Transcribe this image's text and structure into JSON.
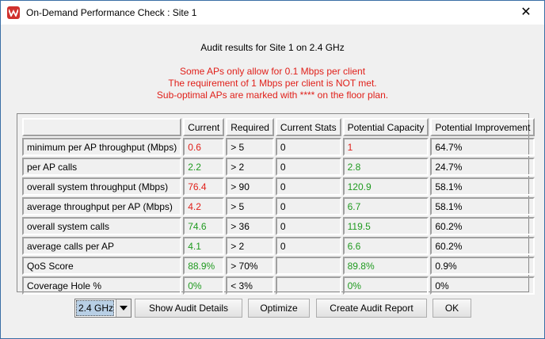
{
  "window": {
    "title": "On-Demand Performance Check : Site 1",
    "close_label": "✕"
  },
  "heading": "Audit results for Site 1 on 2.4 GHz",
  "warnings": [
    "Some APs only allow for 0.1 Mbps per client",
    "The requirement of 1 Mbps per client is NOT met.",
    "Sub-optimal APs are marked with **** on the floor plan."
  ],
  "table": {
    "headers": [
      "",
      "Current",
      "Required",
      "Current Stats",
      "Potential Capacity",
      "Potential Improvement"
    ],
    "rows": [
      [
        "minimum per AP throughput (Mbps)",
        "0.6",
        "> 5",
        "0",
        "1",
        "64.7%"
      ],
      [
        "per AP calls",
        "2.2",
        "> 2",
        "0",
        "2.8",
        "24.7%"
      ],
      [
        "overall system throughput (Mbps)",
        "76.4",
        "> 90",
        "0",
        "120.9",
        "58.1%"
      ],
      [
        "average throughput per AP (Mbps)",
        "4.2",
        "> 5",
        "0",
        "6.7",
        "58.1%"
      ],
      [
        "overall system calls",
        "74.6",
        "> 36",
        "0",
        "119.5",
        "60.2%"
      ],
      [
        "average calls per AP",
        "4.1",
        "> 2",
        "0",
        "6.6",
        "60.2%"
      ],
      [
        "QoS Score",
        "88.9%",
        "> 70%",
        "",
        "89.8%",
        "0.9%"
      ],
      [
        "Coverage Hole %",
        "0%",
        "< 3%",
        "",
        "0%",
        "0%"
      ]
    ],
    "status_colors": {
      "current": [
        "red",
        "green",
        "red",
        "red",
        "green",
        "green",
        "green",
        "green"
      ],
      "potential": [
        "red",
        "green",
        "green",
        "green",
        "green",
        "green",
        "green",
        "green"
      ]
    },
    "colors": {
      "red": "#e0201a",
      "green": "#1f9a1f"
    }
  },
  "controls": {
    "band_select": "2.4 GHz",
    "show_details": "Show Audit Details",
    "optimize": "Optimize",
    "create_report": "Create Audit Report",
    "ok": "OK"
  }
}
